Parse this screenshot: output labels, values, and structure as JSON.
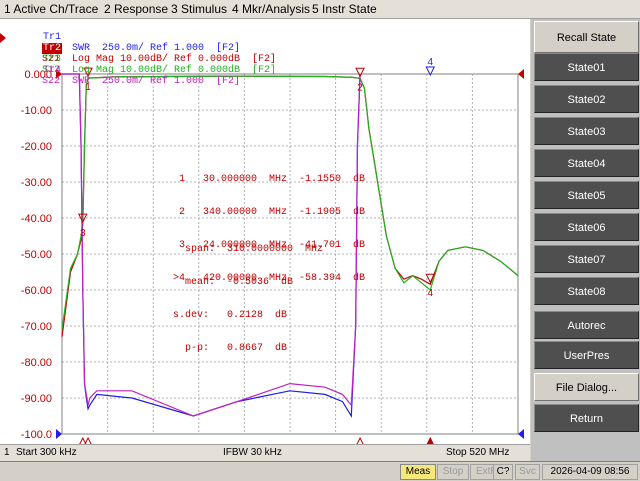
{
  "menu": [
    "1 Active Ch/Trace",
    "2 Response",
    "3 Stimulus",
    "4 Mkr/Analysis",
    "5 Instr State"
  ],
  "traces": [
    {
      "id": "Tr1",
      "text": "S11  SWR  250.0m/ Ref 1.000  [F2]",
      "color": "#1e1ee6"
    },
    {
      "id": "Tr2",
      "text": "S21  Log Mag 10.00dB/ Ref 0.000dB  [F2]",
      "color": "#c00000"
    },
    {
      "id": "Tr3",
      "text": "S12  Log Mag 10.00dB/ Ref 0.000dB  [F2]",
      "color": "#20b020"
    },
    {
      "id": "Tr4",
      "text": "S22  SWR  250.0m/ Ref 1.000  [F2]",
      "color": "#c020c0"
    }
  ],
  "y_labels": [
    "0.000",
    "-10.00",
    "-20.00",
    "-30.00",
    "-40.00",
    "-50.00",
    "-60.00",
    "-70.00",
    "-80.00",
    "-90.00",
    "-100.0"
  ],
  "marker_rows": [
    " 1   30.000000  MHz  -1.1550  dB",
    " 2   340.00000  MHz  -1.1905  dB",
    " 3   24.000000  MHz  -41.701  dB",
    ">4   420.00000  MHz  -58.394  dB"
  ],
  "stats_rows": [
    "  span:  310.0000000  MHz",
    "  mean:  -0.5036  dB",
    "s.dev:   0.2128  dB",
    "  p-p:   0.8667  dB"
  ],
  "bottom": {
    "start": "Start 300 kHz",
    "ifbw": "IFBW 30 kHz",
    "stop": "Stop 520 MHz",
    "channel": "1"
  },
  "status": {
    "meas": "Meas",
    "stop": "Stop",
    "extref": "ExtRef",
    "svc": "Svc",
    "c2": "C?",
    "datetime": "2026-04-09 08:56"
  },
  "softkeys": [
    "Recall State",
    "State01",
    "State02",
    "State03",
    "State04",
    "State05",
    "State06",
    "State07",
    "State08",
    "Autorec",
    "UserPres",
    "File Dialog...",
    "Return"
  ],
  "marker_labels": {
    "m1": "1",
    "m2": "2",
    "m3": "3",
    "m4": "4"
  },
  "chart_data": {
    "type": "line",
    "ylim": [
      -100,
      0
    ],
    "ylabel_unit": "dB",
    "xlim_mhz": [
      0.3,
      520
    ],
    "series": [
      {
        "name": "S21",
        "color": "#c00000",
        "x": [
          0.3,
          10,
          18,
          22,
          24,
          26,
          28,
          30,
          60,
          120,
          200,
          300,
          330,
          340,
          345,
          350,
          360,
          370,
          380,
          390,
          400,
          410,
          420,
          430,
          440,
          460,
          480,
          500,
          520
        ],
        "y": [
          -73,
          -55,
          -50,
          -46,
          -41.7,
          -20,
          -3,
          -1.15,
          -0.8,
          -0.7,
          -0.6,
          -0.7,
          -0.9,
          -1.19,
          -4,
          -15,
          -30,
          -45,
          -54,
          -57,
          -56,
          -57,
          -58.4,
          -52,
          -49,
          -48,
          -49,
          -52,
          -56
        ]
      },
      {
        "name": "S12",
        "color": "#20b020",
        "x": [
          0.3,
          10,
          18,
          22,
          24,
          26,
          28,
          30,
          60,
          120,
          200,
          300,
          330,
          340,
          345,
          350,
          360,
          370,
          380,
          390,
          400,
          410,
          420,
          430,
          440,
          460,
          480,
          500,
          520
        ],
        "y": [
          -71,
          -54,
          -50,
          -45,
          -41,
          -19,
          -3,
          -1.15,
          -0.8,
          -0.7,
          -0.6,
          -0.7,
          -0.9,
          -1.2,
          -4,
          -15,
          -30,
          -45,
          -54,
          -58,
          -56,
          -58,
          -60,
          -52,
          -49,
          -48,
          -49,
          -52,
          -56
        ]
      },
      {
        "name": "S11",
        "color": "#1e1ee6",
        "x": [
          0.3,
          20,
          22,
          24,
          26,
          28,
          30,
          32,
          40,
          80,
          150,
          200,
          260,
          300,
          320,
          330,
          335,
          337,
          340
        ],
        "y": [
          0,
          0,
          -20,
          -60,
          -86,
          -90,
          -93,
          -92,
          -89,
          -90,
          -95,
          -91,
          -88,
          -89,
          -91,
          -95,
          -70,
          -20,
          0
        ]
      },
      {
        "name": "S22",
        "color": "#c020c0",
        "x": [
          0.3,
          20,
          22,
          24,
          26,
          28,
          30,
          32,
          40,
          80,
          150,
          200,
          260,
          300,
          320,
          330,
          335,
          337,
          340
        ],
        "y": [
          0,
          0,
          -20,
          -60,
          -86,
          -89,
          -92,
          -90,
          -88,
          -88,
          -95,
          -91,
          -86,
          -87,
          -89,
          -92,
          -70,
          -20,
          0
        ]
      }
    ]
  }
}
